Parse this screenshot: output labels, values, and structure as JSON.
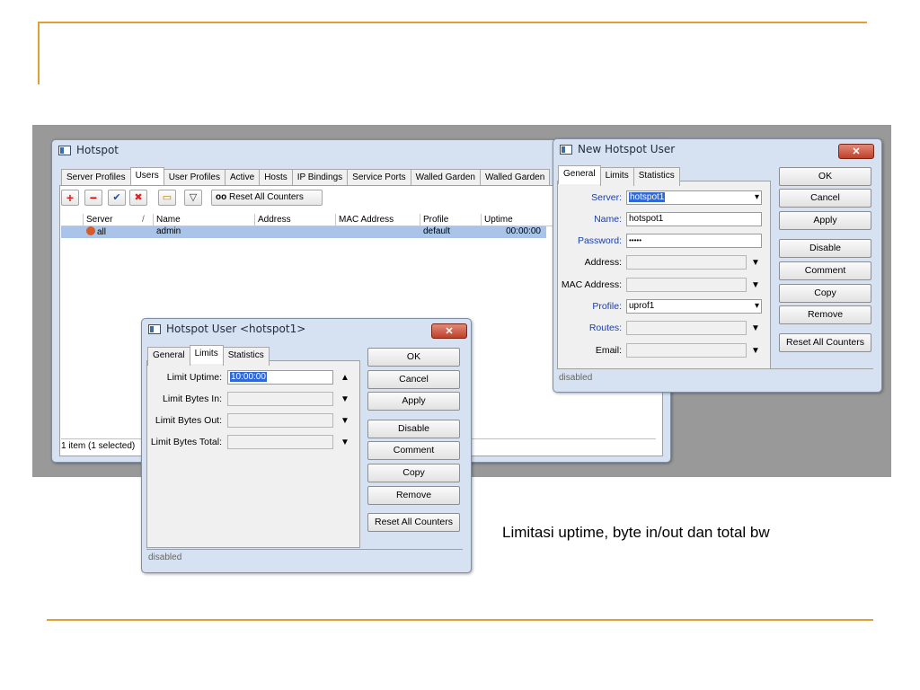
{
  "caption": "Limitasi uptime, byte in/out dan total bw",
  "hotspot": {
    "title": "Hotspot",
    "tabs": [
      "Server Profiles",
      "Users",
      "User Profiles",
      "Active",
      "Hosts",
      "IP Bindings",
      "Service Ports",
      "Walled Garden",
      "Walled Garden"
    ],
    "active_tab": "Users",
    "toolbar": {
      "add": "+",
      "remove": "−",
      "enable": "✔",
      "disable": "✖",
      "comment": "▭",
      "filter": "▽",
      "reset_glyph": "oo",
      "reset_label": "Reset All Counters"
    },
    "columns": [
      "Server",
      "/",
      "Name",
      "Address",
      "MAC Address",
      "Profile",
      "Uptime"
    ],
    "rows": [
      {
        "server": "all",
        "name": "admin",
        "address": "",
        "mac": "",
        "profile": "default",
        "uptime": "00:00:00"
      }
    ],
    "status": "1 item (1 selected)"
  },
  "user_dialog": {
    "title": "Hotspot User <hotspot1>",
    "tabs": [
      "General",
      "Limits",
      "Statistics"
    ],
    "active_tab": "Limits",
    "fields": {
      "limit_uptime_label": "Limit Uptime:",
      "limit_uptime_value": "10:00:00",
      "limit_bytes_in_label": "Limit Bytes In:",
      "limit_bytes_out_label": "Limit Bytes Out:",
      "limit_bytes_total_label": "Limit Bytes Total:"
    },
    "buttons": [
      "OK",
      "Cancel",
      "Apply",
      "Disable",
      "Comment",
      "Copy",
      "Remove",
      "Reset All Counters"
    ],
    "status": "disabled",
    "close": "✕"
  },
  "new_user_dialog": {
    "title": "New Hotspot User",
    "tabs": [
      "General",
      "Limits",
      "Statistics"
    ],
    "active_tab": "General",
    "fields": {
      "server_label": "Server:",
      "server_value": "hotspot1",
      "name_label": "Name:",
      "name_value": "hotspot1",
      "password_label": "Password:",
      "password_value": "•••••",
      "address_label": "Address:",
      "mac_label": "MAC Address:",
      "profile_label": "Profile:",
      "profile_value": "uprof1",
      "routes_label": "Routes:",
      "email_label": "Email:"
    },
    "buttons": [
      "OK",
      "Cancel",
      "Apply",
      "Disable",
      "Comment",
      "Copy",
      "Remove",
      "Reset All Counters"
    ],
    "status": "disabled",
    "close": "✕"
  },
  "colors": {
    "rule": "#e1a036",
    "band": "#999999",
    "selected_row": "#a9c4e8",
    "label_blue": "#1a3ea8"
  }
}
